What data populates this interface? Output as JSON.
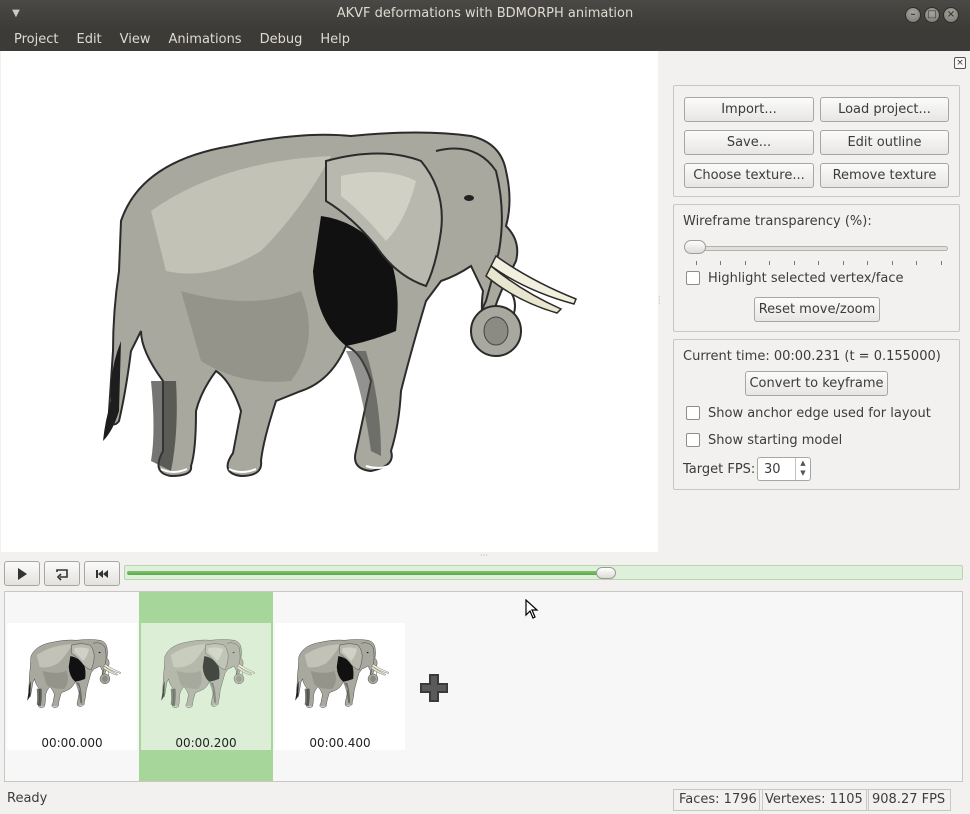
{
  "window": {
    "title": "AKVF deformations with BDMORPH animation"
  },
  "menubar": [
    "Project",
    "Edit",
    "View",
    "Animations",
    "Debug",
    "Help"
  ],
  "project_group": {
    "import_label": "Import...",
    "load_project_label": "Load project...",
    "save_label": "Save...",
    "edit_outline_label": "Edit outline",
    "choose_texture_label": "Choose texture...",
    "remove_texture_label": "Remove texture"
  },
  "view_group": {
    "wireframe_label": "Wireframe transparency (%):",
    "wireframe_value": 0,
    "highlight_label": "Highlight selected vertex/face",
    "highlight_checked": false,
    "reset_label": "Reset move/zoom"
  },
  "animation_group": {
    "current_time": "Current time: 00:00.231 (t = 0.155000)",
    "convert_label": "Convert to keyframe",
    "anchor_label": "Show anchor edge used for layout",
    "anchor_checked": false,
    "starting_model_label": "Show starting model",
    "starting_model_checked": false,
    "fps_label": "Target FPS:",
    "fps_value": "30"
  },
  "transport": {
    "play_icon": "play-icon",
    "repeat_icon": "repeat-icon",
    "rewind_icon": "skip-to-start-icon",
    "progress": 0.575
  },
  "keyframes": [
    {
      "time": "00:00.000",
      "selected": false
    },
    {
      "time": "00:00.200",
      "selected": true
    },
    {
      "time": "00:00.400",
      "selected": false
    }
  ],
  "statusbar": {
    "status": "Ready",
    "faces": "Faces: 1796",
    "vertexes": "Vertexes: 1105",
    "fps": "908.27 FPS"
  },
  "colors": {
    "titlebar": "#3c3b37",
    "accent_green": "#a6d69a",
    "timeline_fill": "#6fb85f"
  }
}
